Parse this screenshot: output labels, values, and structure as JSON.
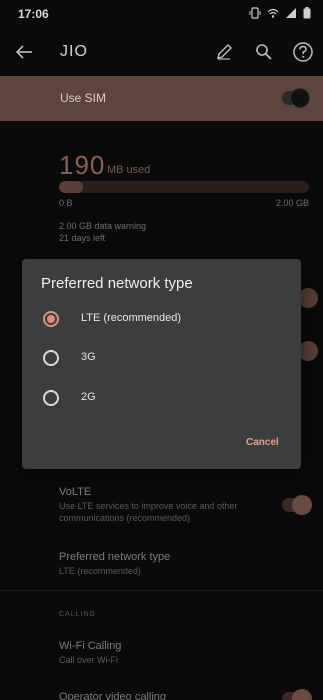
{
  "status_bar": {
    "time": "17:06",
    "icons": [
      "vibrate-icon",
      "wifi-icon",
      "signal-icon",
      "battery-icon"
    ]
  },
  "app_bar": {
    "title": "JIO",
    "icons": [
      "back-arrow-icon",
      "pencil-icon",
      "search-icon",
      "help-icon"
    ]
  },
  "use_sim": {
    "label": "Use SIM",
    "enabled": true
  },
  "usage": {
    "amount": "190",
    "unit": "MB used",
    "min_label": "0 B",
    "max_label": "2.00 GB",
    "fill_fraction": 0.095,
    "warning": "2.00 GB data warning",
    "days_left": "21 days left"
  },
  "settings": {
    "volte_title": "VoLTE",
    "volte_subtitle": "Use LTE services to improve voice and other communications (recommended)",
    "preferred_title": "Preferred network type",
    "preferred_subtitle": "LTE (recommended)",
    "calling_header": "CALLING",
    "wifi_title": "Wi-Fi Calling",
    "wifi_subtitle": "Call over Wi-Fi",
    "operator_title": "Operator video calling"
  },
  "dialog": {
    "title": "Preferred network type",
    "options": [
      {
        "label": "LTE (recommended)",
        "selected": true
      },
      {
        "label": "3G",
        "selected": false
      },
      {
        "label": "2G",
        "selected": false
      }
    ],
    "cancel_label": "Cancel"
  },
  "colors": {
    "accent": "#e0907a",
    "sim_row_bg": "#5b453c",
    "dialog_bg": "#3b3d3e"
  }
}
